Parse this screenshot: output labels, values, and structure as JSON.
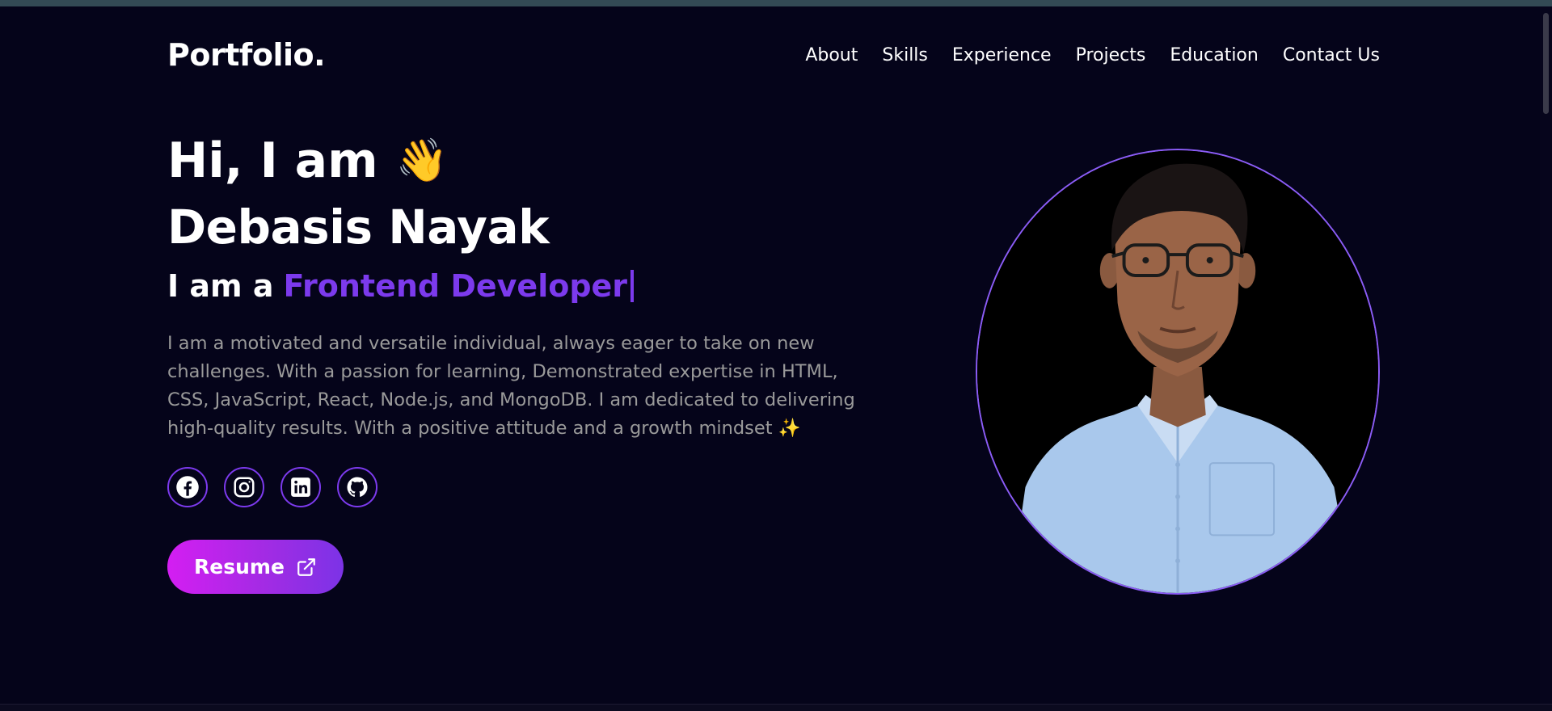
{
  "brand": {
    "logo": "Portfolio."
  },
  "nav": {
    "items": [
      {
        "label": "About"
      },
      {
        "label": "Skills"
      },
      {
        "label": "Experience"
      },
      {
        "label": "Projects"
      },
      {
        "label": "Education"
      },
      {
        "label": "Contact Us"
      }
    ]
  },
  "hero": {
    "greeting": "Hi, I am",
    "greeting_icon": "👋",
    "name": "Debasis Nayak",
    "role_prefix": "I am a",
    "role_typed": "Frontend Developer",
    "bio": "I am a motivated and versatile individual, always eager to take on new challenges. With a passion for learning, Demonstrated expertise in HTML, CSS, JavaScript, React, Node.js, and MongoDB. I am dedicated to delivering high-quality results. With a positive attitude and a growth mindset ✨",
    "resume_label": "Resume"
  },
  "social": [
    {
      "icon": "facebook-icon"
    },
    {
      "icon": "instagram-icon"
    },
    {
      "icon": "linkedin-icon"
    },
    {
      "icon": "github-icon"
    }
  ],
  "colors": {
    "background": "#05041a",
    "accent": "#7c3aed",
    "button_gradient_start": "#d41ef2",
    "button_gradient_end": "#7c33e6",
    "muted_text": "#9a9a9a"
  }
}
